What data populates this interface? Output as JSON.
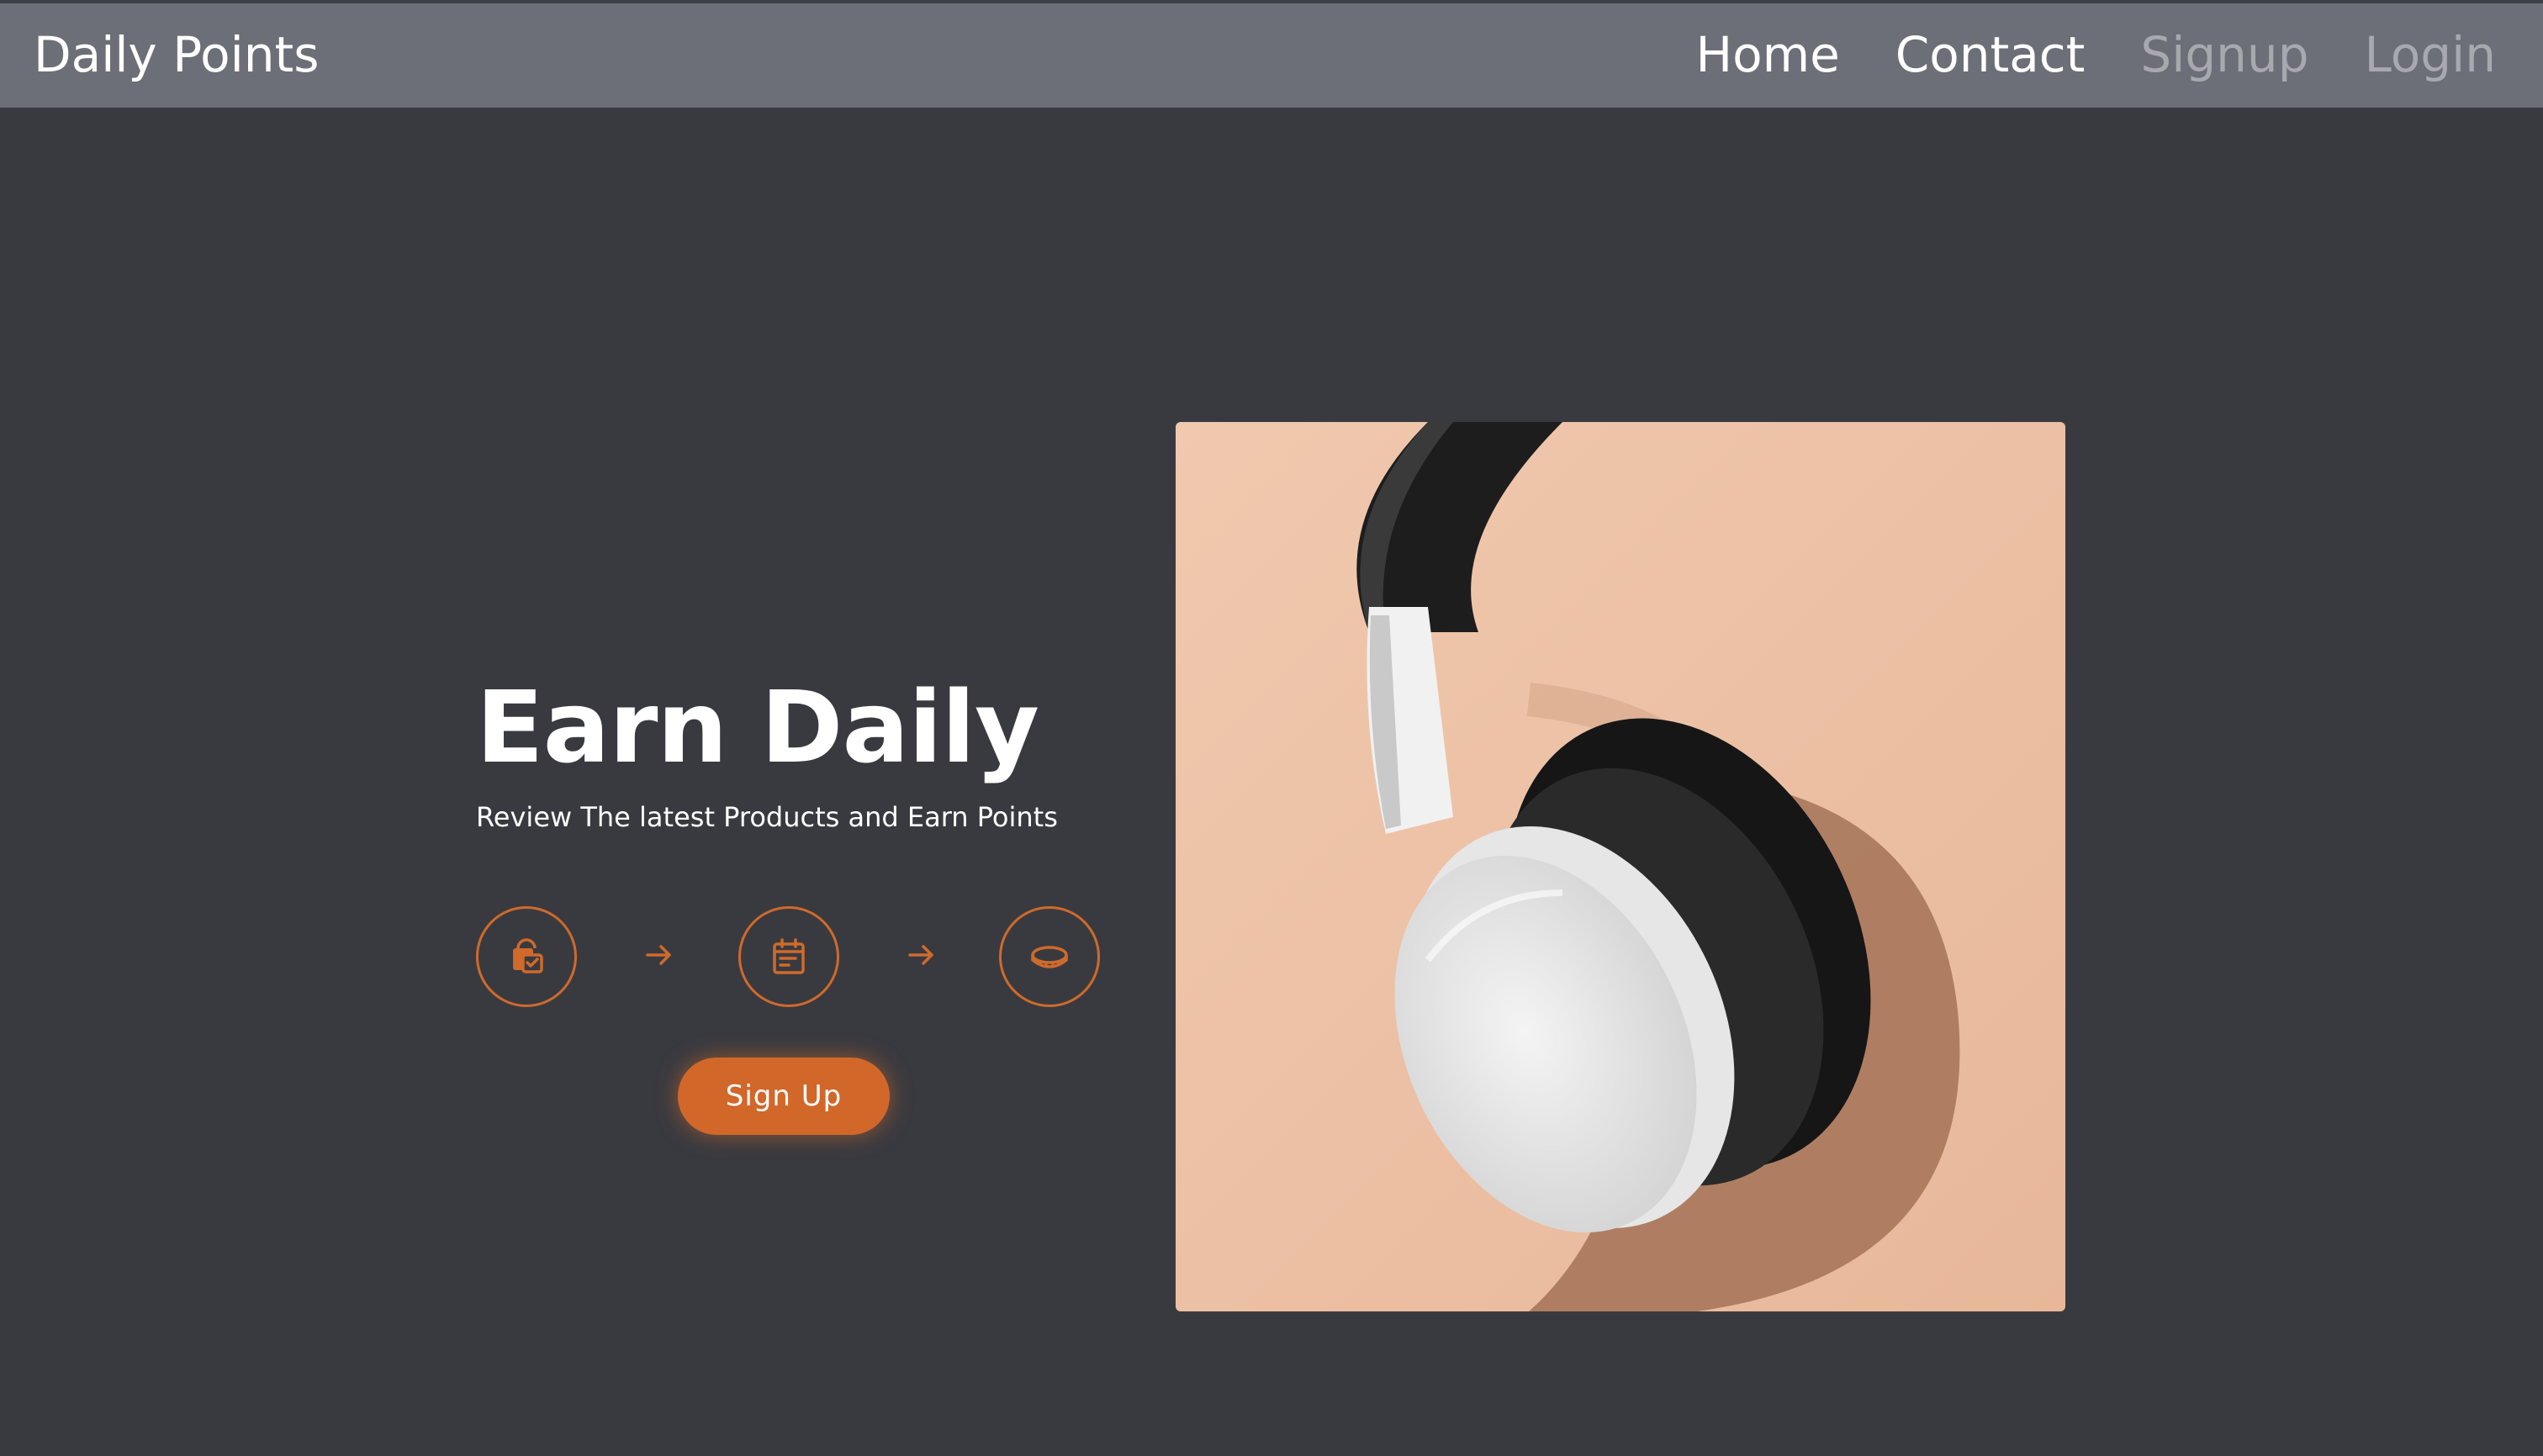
{
  "header": {
    "brand": "Daily Points",
    "nav": [
      {
        "label": "Home",
        "state": "active"
      },
      {
        "label": "Contact",
        "state": "active"
      },
      {
        "label": "Signup",
        "state": "muted"
      },
      {
        "label": "Login",
        "state": "muted"
      }
    ]
  },
  "hero": {
    "title": "Earn Daily",
    "subtitle": "Review The latest Products and Earn Points",
    "steps": [
      {
        "icon": "shopping-bag-check-icon"
      },
      {
        "icon": "calendar-note-icon"
      },
      {
        "icon": "coin-icon"
      }
    ],
    "cta_label": "Sign Up",
    "image": {
      "subject": "white-and-black-headphones-photo"
    }
  },
  "colors": {
    "nav_bg": "#6c6f77",
    "page_bg": "#393a40",
    "accent": "#d2672a",
    "text_primary": "#ffffff",
    "text_muted": "#a7a9ae",
    "image_bg": "#eec3a8"
  }
}
